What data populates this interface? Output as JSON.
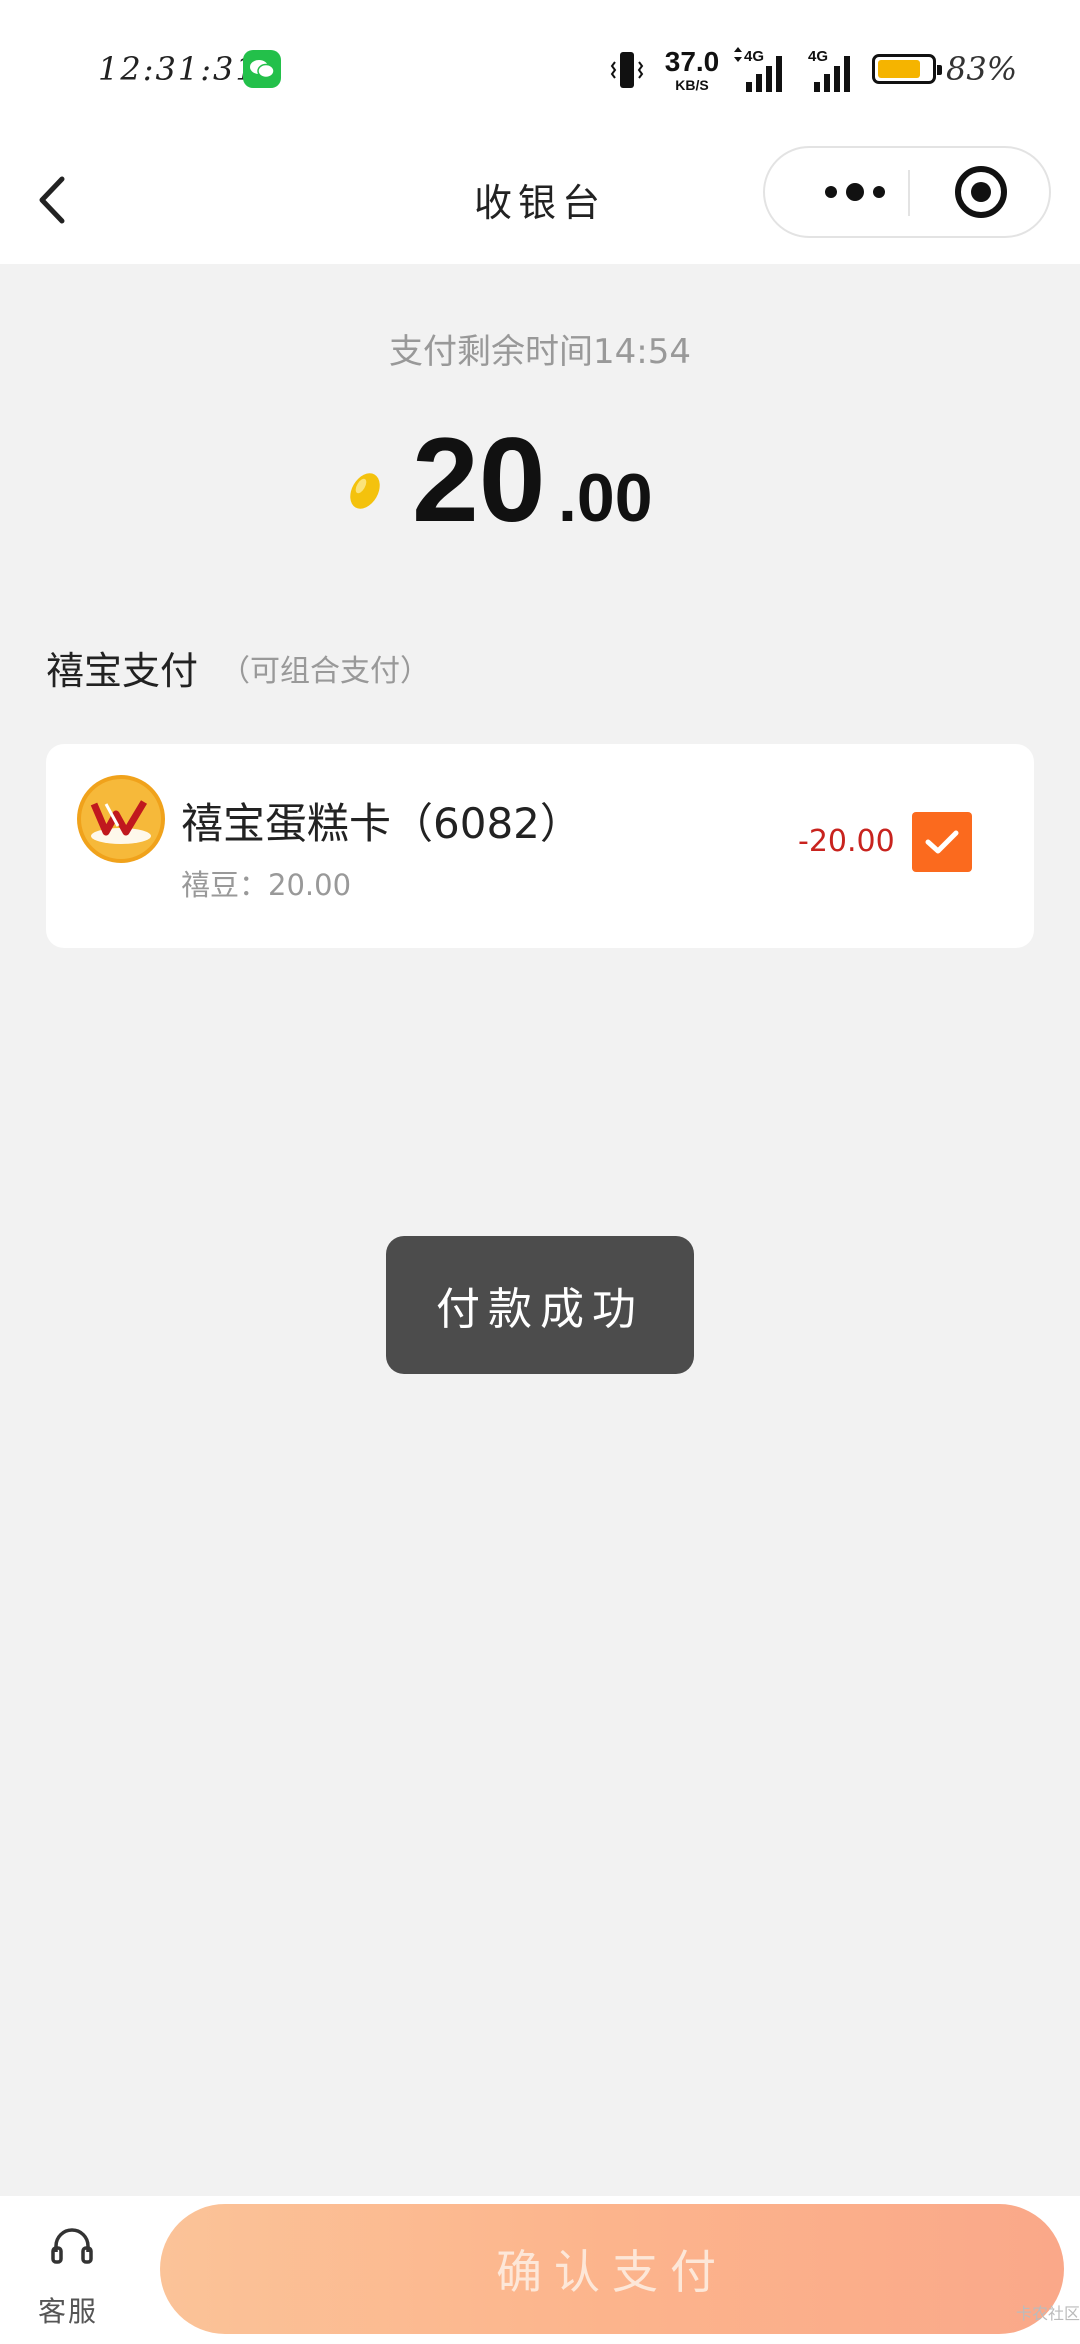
{
  "status_bar": {
    "time": "12:31:31",
    "network_speed_value": "37.0",
    "network_speed_unit": "KB/S",
    "signal_1_label": "4G",
    "signal_2_label": "4G",
    "battery_percent": "83%",
    "battery_level": 0.83,
    "battery_color": "#f5b400"
  },
  "nav": {
    "title": "收银台",
    "back_icon": "chevron-left-icon",
    "more_icon": "more-dots-icon",
    "close_icon": "target-circle-icon"
  },
  "payment": {
    "countdown_text": "支付剩余时间14:54",
    "amount_integer": "20",
    "amount_decimal": ".00",
    "currency_icon": "gold-bean-icon"
  },
  "section": {
    "title": "禧宝支付",
    "subtitle": "（可组合支付）"
  },
  "card": {
    "name": "禧宝蛋糕卡（6082）",
    "balance": "禧豆：20.00",
    "deduct": "-20.00",
    "checked": true,
    "accent_color": "#fb6a1e"
  },
  "toast": {
    "text": "付款成功"
  },
  "bottom": {
    "customer_service_label": "客服",
    "confirm_label": "确认支付"
  },
  "watermark": "卡农社区"
}
